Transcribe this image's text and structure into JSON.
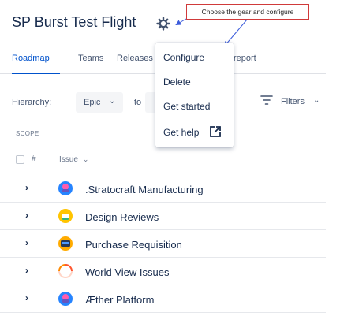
{
  "header": {
    "title": "SP Burst Test Flight",
    "gear_icon": "gear-icon"
  },
  "annotation": {
    "callout_text": "Choose the gear and configure",
    "border_color": "#d03a3a"
  },
  "tabs": [
    {
      "label": "Roadmap",
      "active": true
    },
    {
      "label": "Teams",
      "active": false
    },
    {
      "label": "Releases",
      "active": false
    },
    {
      "label": "report",
      "active": false
    }
  ],
  "menu": {
    "items": [
      {
        "label": "Configure"
      },
      {
        "label": "Delete"
      },
      {
        "label": "Get started"
      },
      {
        "label": "Get help",
        "icon": "external-link-icon"
      }
    ]
  },
  "toolbar": {
    "hierarchy_label": "Hierarchy:",
    "hierarchy_from": "Epic",
    "to_label": "to",
    "filters_label": "Filters"
  },
  "table": {
    "scope_label": "SCOPE",
    "hash_label": "#",
    "issue_label": "Issue",
    "rows": [
      {
        "label": ".Stratocraft Manufacturing",
        "icon": "avatar-blue-icon"
      },
      {
        "label": "Design Reviews",
        "icon": "avatar-yellow-icon"
      },
      {
        "label": "Purchase Requisition",
        "icon": "avatar-dark-icon"
      },
      {
        "label": "World View Issues",
        "icon": "avatar-spinner-icon"
      },
      {
        "label": "Æther Platform",
        "icon": "avatar-blue-icon"
      }
    ]
  },
  "colors": {
    "accent": "#0052cc",
    "text": "#172b4d",
    "muted": "#42526e"
  }
}
